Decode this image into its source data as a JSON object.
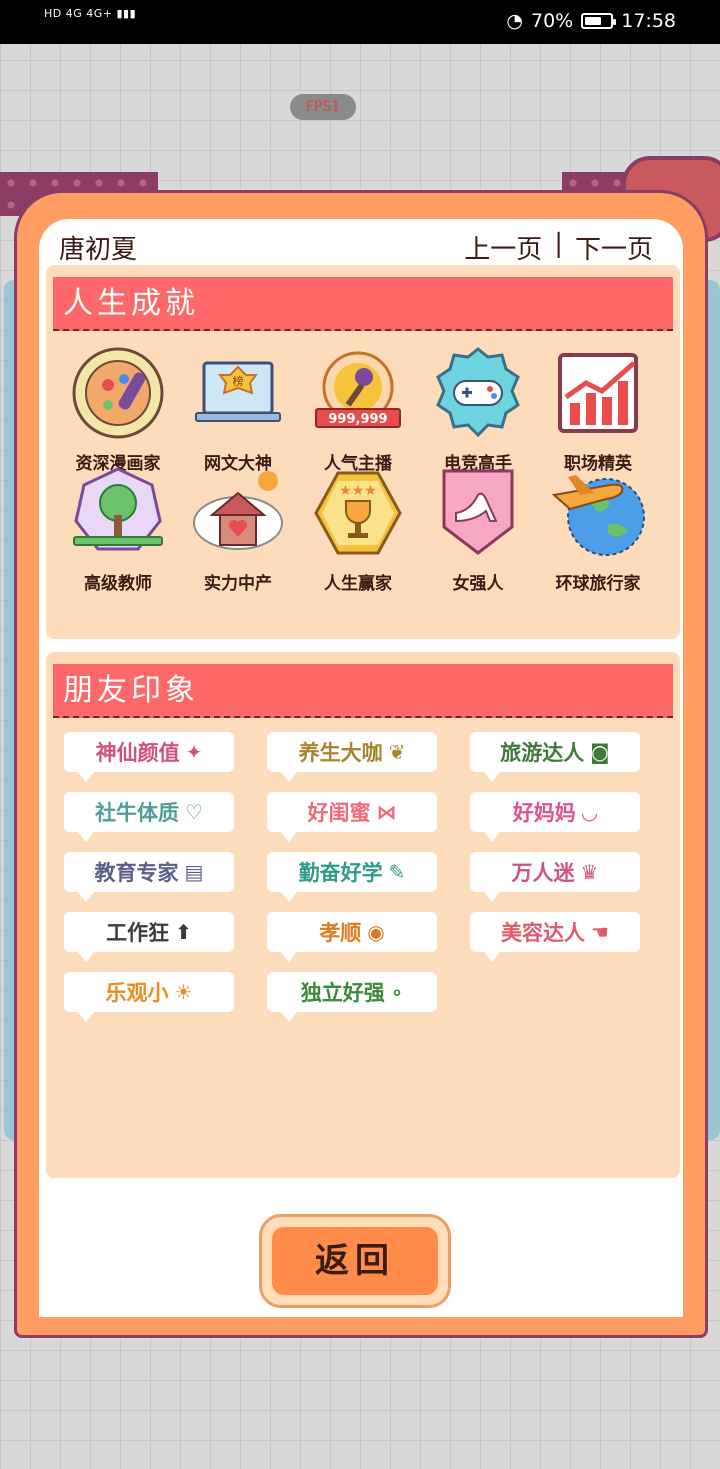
{
  "status_bar": {
    "left_text": "HD 4G 4G+",
    "battery_percent": "70%",
    "battery_level": 0.7,
    "time": "17:58"
  },
  "fps_label": "FPS1",
  "header": {
    "player_name": "唐初夏",
    "prev_page": "上一页",
    "separator": "|",
    "next_page": "下一页"
  },
  "achievements": {
    "title": "人生成就",
    "items": [
      {
        "label": "资深漫画家",
        "icon": "palette-icon"
      },
      {
        "label": "网文大神",
        "icon": "laptop-ranking-icon"
      },
      {
        "label": "人气主播",
        "icon": "microphone-icon",
        "badge_text": "999,999"
      },
      {
        "label": "电竞高手",
        "icon": "gamepad-icon"
      },
      {
        "label": "职场精英",
        "icon": "rising-chart-icon"
      },
      {
        "label": "高级教师",
        "icon": "tree-book-icon"
      },
      {
        "label": "实力中产",
        "icon": "house-heart-icon"
      },
      {
        "label": "人生赢家",
        "icon": "trophy-icon"
      },
      {
        "label": "女强人",
        "icon": "high-heel-icon"
      },
      {
        "label": "环球旅行家",
        "icon": "plane-globe-icon"
      }
    ]
  },
  "friends": {
    "title": "朋友印象",
    "tags": [
      {
        "label": "神仙颜值",
        "color": "#d0527a",
        "icon": "sparkle-icon"
      },
      {
        "label": "养生大咖",
        "color": "#a8842e",
        "icon": "leaf-icon"
      },
      {
        "label": "旅游达人",
        "color": "#3f7a3a",
        "icon": "camera-icon"
      },
      {
        "label": "社牛体质",
        "color": "#4f9e9a",
        "icon": "speech-heart-icon"
      },
      {
        "label": "好闺蜜",
        "color": "#f06a7a",
        "icon": "bow-icon"
      },
      {
        "label": "好妈妈",
        "color": "#e0528a",
        "icon": "smile-icon"
      },
      {
        "label": "教育专家",
        "color": "#5a5f8a",
        "icon": "book-icon"
      },
      {
        "label": "勤奋好学",
        "color": "#2e9a8a",
        "icon": "pencil-icon"
      },
      {
        "label": "万人迷",
        "color": "#d0527a",
        "icon": "crown-icon"
      },
      {
        "label": "工作狂",
        "color": "#3b3b3b",
        "icon": "arrow-up-icon"
      },
      {
        "label": "孝顺",
        "color": "#e07a1e",
        "icon": "egg-icon"
      },
      {
        "label": "美容达人",
        "color": "#e05a6a",
        "icon": "hand-icon"
      },
      {
        "label": "乐观小",
        "color": "#f08a1e",
        "icon": "sun-icon"
      },
      {
        "label": "独立好强",
        "color": "#3a8a3a",
        "icon": "dots-icon"
      }
    ]
  },
  "back_button": "返回"
}
